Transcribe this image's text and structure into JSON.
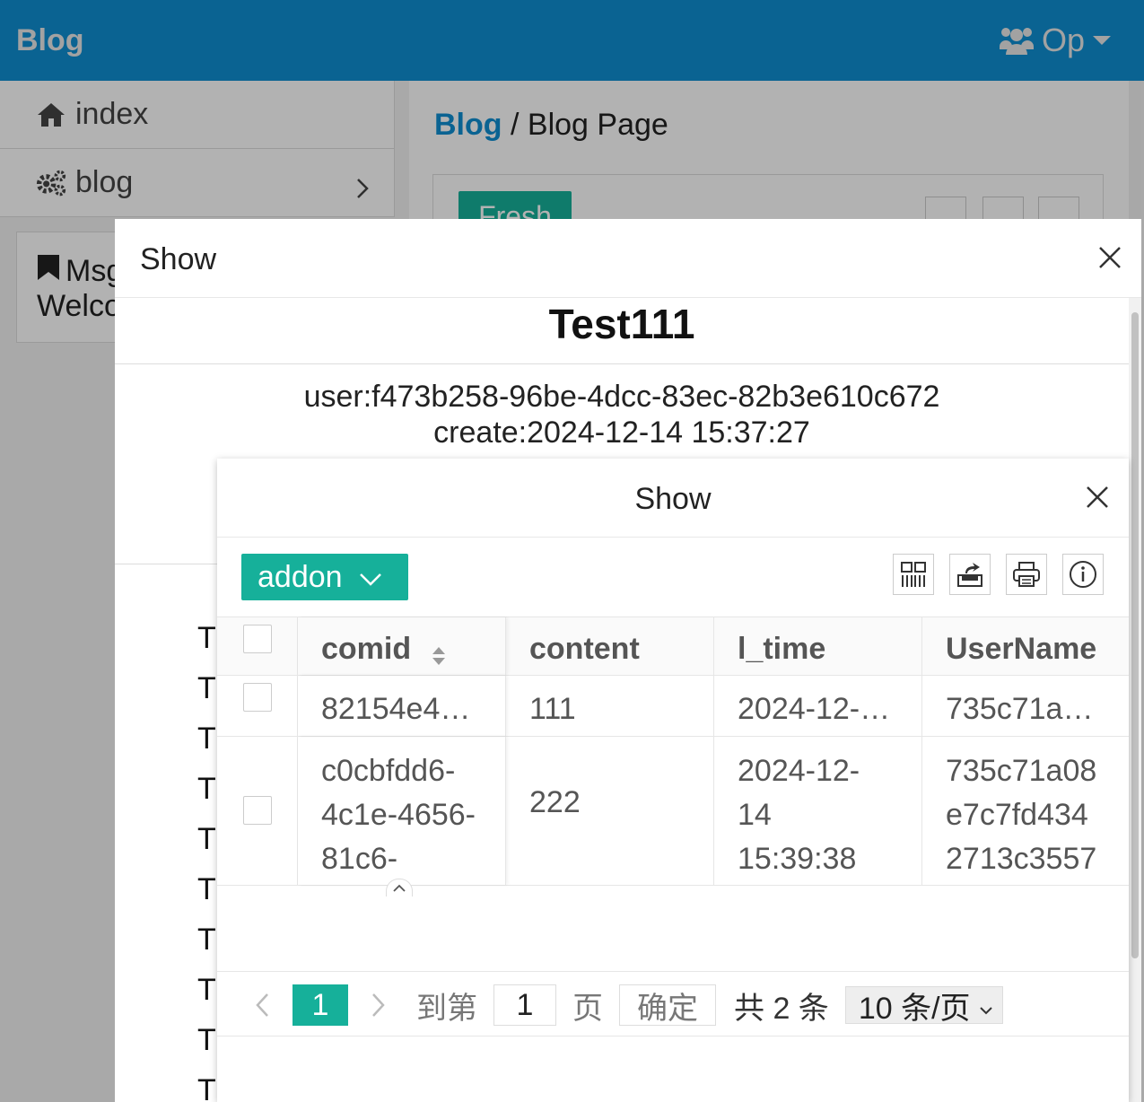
{
  "header": {
    "brand": "Blog",
    "user_label": "Op"
  },
  "sidebar": {
    "items": [
      {
        "label": "index",
        "icon": "home-icon"
      },
      {
        "label": "blog",
        "icon": "gears-icon"
      }
    ]
  },
  "msg_card": {
    "title": "Msg",
    "text": "Welcome"
  },
  "breadcrumb": {
    "link": "Blog",
    "separator": "/",
    "current": "Blog Page"
  },
  "panel": {
    "fresh_label": "Fresh"
  },
  "modal1": {
    "title": "Show",
    "blog_title": "Test111",
    "user_line": "user:f473b258-96be-4dcc-83ec-82b3e610c672",
    "create_line": "create:2024-12-14 15:37:27",
    "list_prefix": "T"
  },
  "modal2": {
    "title": "Show",
    "addon_label": "addon",
    "columns": [
      "comid",
      "content",
      "l_time",
      "UserName"
    ],
    "rows": [
      {
        "comid": "82154e4…",
        "content": "111",
        "l_time": "2024-12-…",
        "user": "735c71a…"
      },
      {
        "comid": "c0cbfdd6-\n4c1e-4656-\n81c6-",
        "content": "222",
        "l_time": "2024-12-\n14\n15:39:38",
        "user": "735c71a08\ne7c7fd434\n2713c3557"
      }
    ],
    "pager": {
      "current": "1",
      "goto_label": "到第",
      "goto_value": "1",
      "page_label": "页",
      "confirm_label": "确定",
      "total_label": "共 2 条",
      "page_size": "10 条/页"
    }
  },
  "colors": {
    "header_bg": "#0f8fd2",
    "accent": "#16b09a"
  }
}
